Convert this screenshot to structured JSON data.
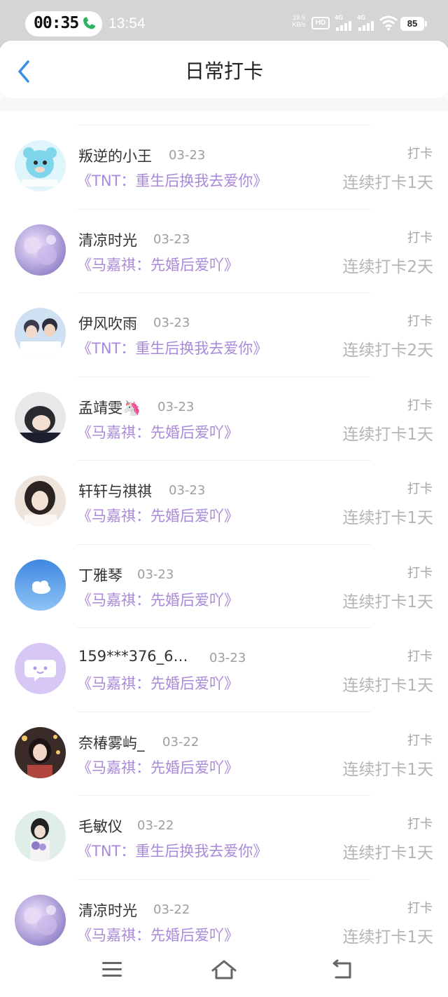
{
  "status_bar": {
    "call_time": "00:35",
    "clock": "13:54",
    "net_speed_value": "19.9",
    "net_speed_unit": "KB/s",
    "hd_badge": "HD",
    "signal1_label": "4G",
    "signal2_label": "4G",
    "battery": "85"
  },
  "header": {
    "title": "日常打卡"
  },
  "entries": [
    {
      "name": "叛逆的小王",
      "date": "03-23",
      "book": "《TNT：重生后换我去爱你》",
      "action": "打卡",
      "streak": "连续打卡1天"
    },
    {
      "name": "清凉时光",
      "date": "03-23",
      "book": "《马嘉祺：先婚后爱吖》",
      "action": "打卡",
      "streak": "连续打卡2天"
    },
    {
      "name": "伊风吹雨",
      "date": "03-23",
      "book": "《TNT：重生后换我去爱你》",
      "action": "打卡",
      "streak": "连续打卡2天"
    },
    {
      "name": "孟靖雯🦄",
      "date": "03-23",
      "book": "《马嘉祺：先婚后爱吖》",
      "action": "打卡",
      "streak": "连续打卡1天"
    },
    {
      "name": "轩轩与祺祺",
      "date": "03-23",
      "book": "《马嘉祺：先婚后爱吖》",
      "action": "打卡",
      "streak": "连续打卡1天"
    },
    {
      "name": "丁雅琴",
      "date": "03-23",
      "book": "《马嘉祺：先婚后爱吖》",
      "action": "打卡",
      "streak": "连续打卡1天"
    },
    {
      "name": "159***376_6…",
      "date": "03-23",
      "book": "《马嘉祺：先婚后爱吖》",
      "action": "打卡",
      "streak": "连续打卡1天"
    },
    {
      "name": "奈椿雾屿_",
      "date": "03-22",
      "book": "《马嘉祺：先婚后爱吖》",
      "action": "打卡",
      "streak": "连续打卡1天"
    },
    {
      "name": "毛敏仪",
      "date": "03-22",
      "book": "《TNT：重生后换我去爱你》",
      "action": "打卡",
      "streak": "连续打卡1天"
    },
    {
      "name": "清凉时光",
      "date": "03-22",
      "book": "《马嘉祺：先婚后爱吖》",
      "action": "打卡",
      "streak": "连续打卡1天"
    }
  ],
  "colors": {
    "accent": "#3a8ee6",
    "book_title": "#a98ad8",
    "muted": "#a6a6a6"
  }
}
